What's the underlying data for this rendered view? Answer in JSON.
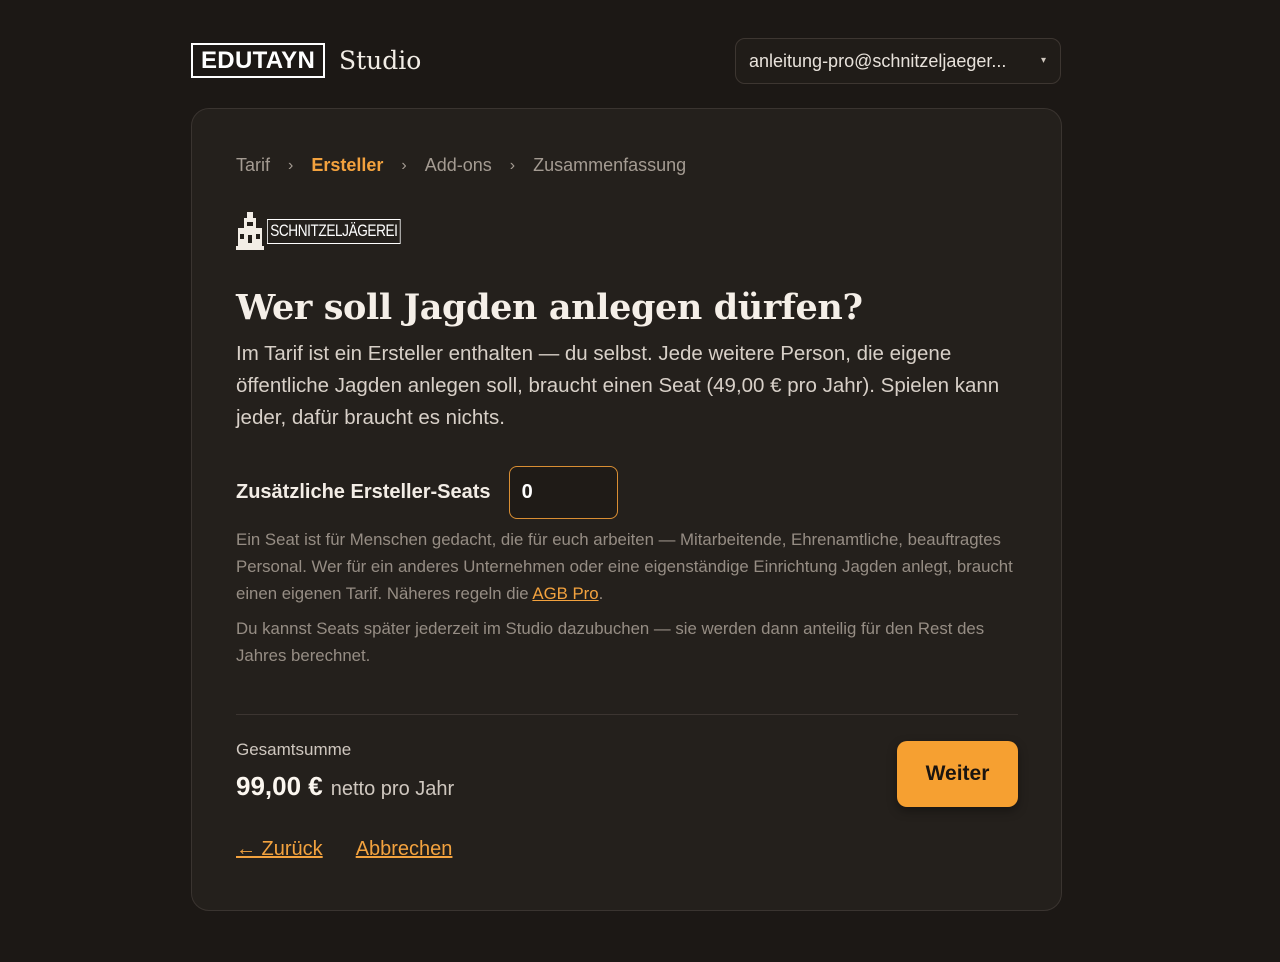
{
  "header": {
    "logo_text": "EDUTAYN",
    "product": "Studio",
    "account_email": "anleitung-pro@schnitzeljaeger...",
    "account_caret": "▾"
  },
  "breadcrumb": {
    "items": [
      {
        "label": "Tarif",
        "active": false
      },
      {
        "label": "Ersteller",
        "active": true
      },
      {
        "label": "Add-ons",
        "active": false
      },
      {
        "label": "Zusammenfassung",
        "active": false
      }
    ],
    "separator": "›"
  },
  "brand": {
    "logo_text": "SCHNITZELJÄGEREI"
  },
  "main": {
    "title": "Wer soll Jagden anlegen dürfen?",
    "intro": "Im Tarif ist ein Ersteller enthalten — du selbst. Jede weitere Person, die eigene öffentliche Jagden anlegen soll, braucht einen Seat (49,00 € pro Jahr). Spielen kann jeder, dafür braucht es nichts.",
    "seats_label": "Zusätzliche Ersteller-Seats",
    "seats_value": "0",
    "note1_text": "Ein Seat ist für Menschen gedacht, die für euch arbeiten — Mitarbeitende, Ehrenamtliche, beauftragtes Personal. Wer für ein anderes Unternehmen oder eine eigenständige Einrichtung Jagden anlegt, braucht einen eigenen Tarif. Näheres regeln die ",
    "note1_link": "AGB Pro",
    "note1_end": ".",
    "note2": "Du kannst Seats später jederzeit im Studio dazubuchen — sie werden dann anteilig für den Rest des Jahres berechnet."
  },
  "summary": {
    "total_label": "Gesamtsumme",
    "total_amount": "99,00 €",
    "total_suffix": "netto pro Jahr",
    "continue_label": "Weiter",
    "back_label": "← Zurück",
    "cancel_label": "Abbrechen"
  },
  "colors": {
    "accent": "#f6a031",
    "background": "#1c1815",
    "card": "#24201c"
  }
}
